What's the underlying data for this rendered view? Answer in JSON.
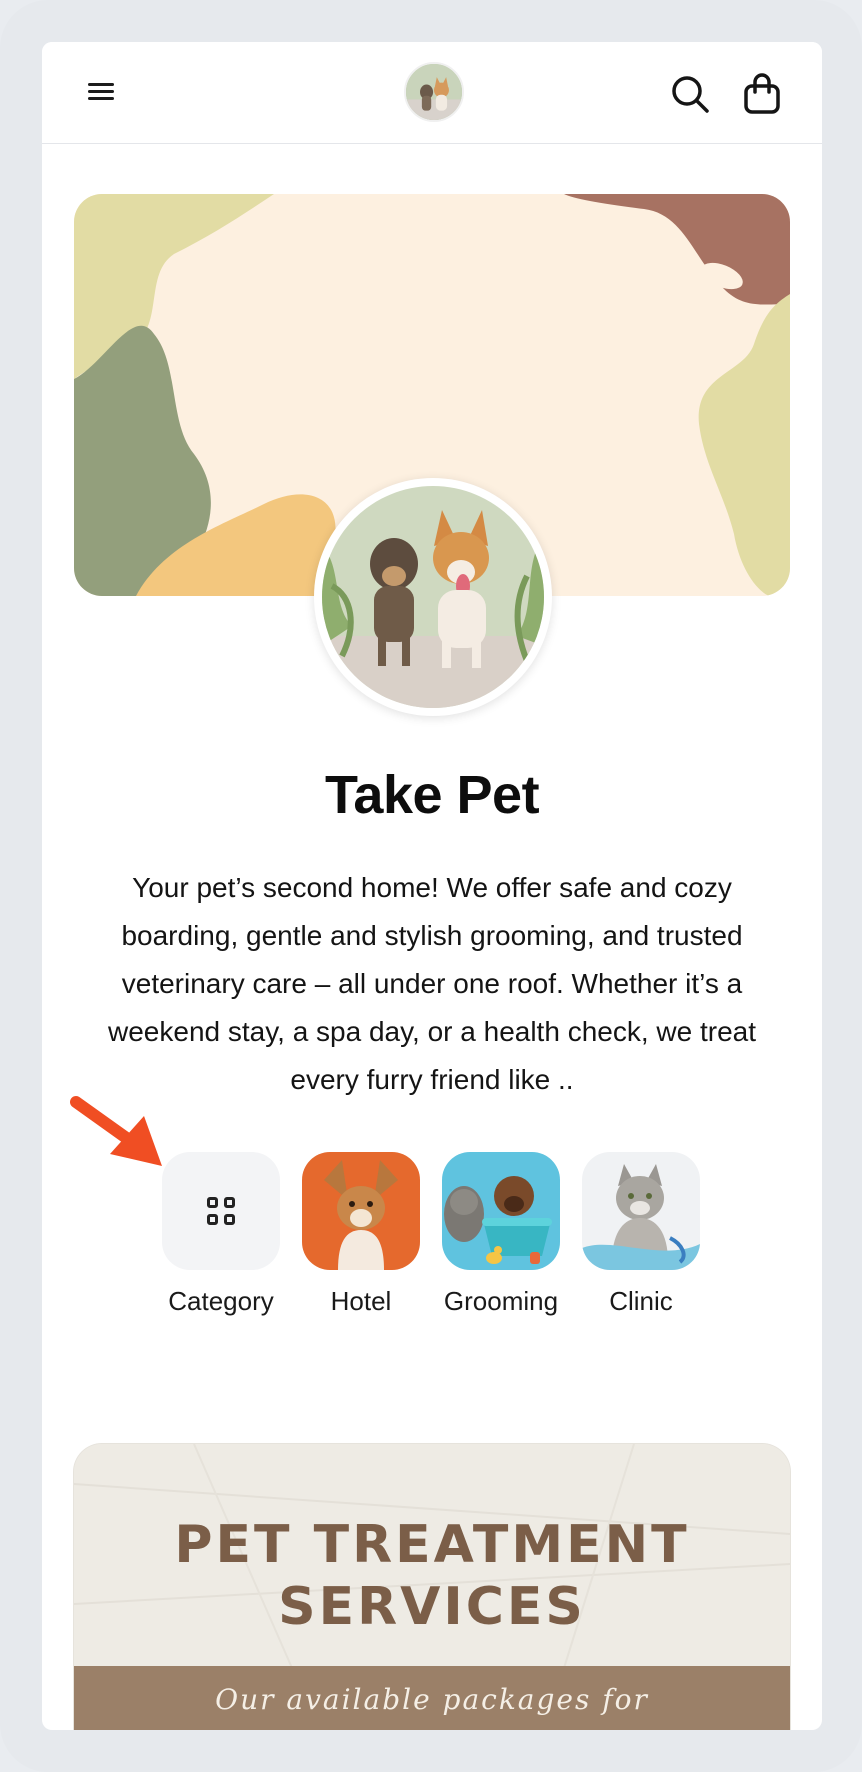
{
  "header": {
    "menu_icon": "hamburger-menu-icon",
    "logo_icon": "two-dogs-logo",
    "search_icon": "search-icon",
    "cart_icon": "shopping-bag-icon"
  },
  "store": {
    "name": "Take Pet",
    "description": "Your pet’s second home! We offer safe and cozy boarding, gentle and stylish grooming, and trusted veterinary care – all under one roof. Whether it’s a weekend stay, a spa day, or a health check, we treat every furry friend like .."
  },
  "categories": [
    {
      "label": "Category",
      "icon": "grid-icon"
    },
    {
      "label": "Hotel",
      "icon": "puppy-photo"
    },
    {
      "label": "Grooming",
      "icon": "cat-and-dog-bath-photo"
    },
    {
      "label": "Clinic",
      "icon": "cat-with-stethoscope-photo"
    }
  ],
  "promo": {
    "title_line1": "PET TREATMENT",
    "title_line2": "SERVICES",
    "subtitle": "Our available packages for"
  },
  "colors": {
    "arrow": "#f04e23",
    "promo_title": "#7b5e48",
    "promo_band": "#9b8068",
    "banner_bg": "#fdf0e0"
  }
}
